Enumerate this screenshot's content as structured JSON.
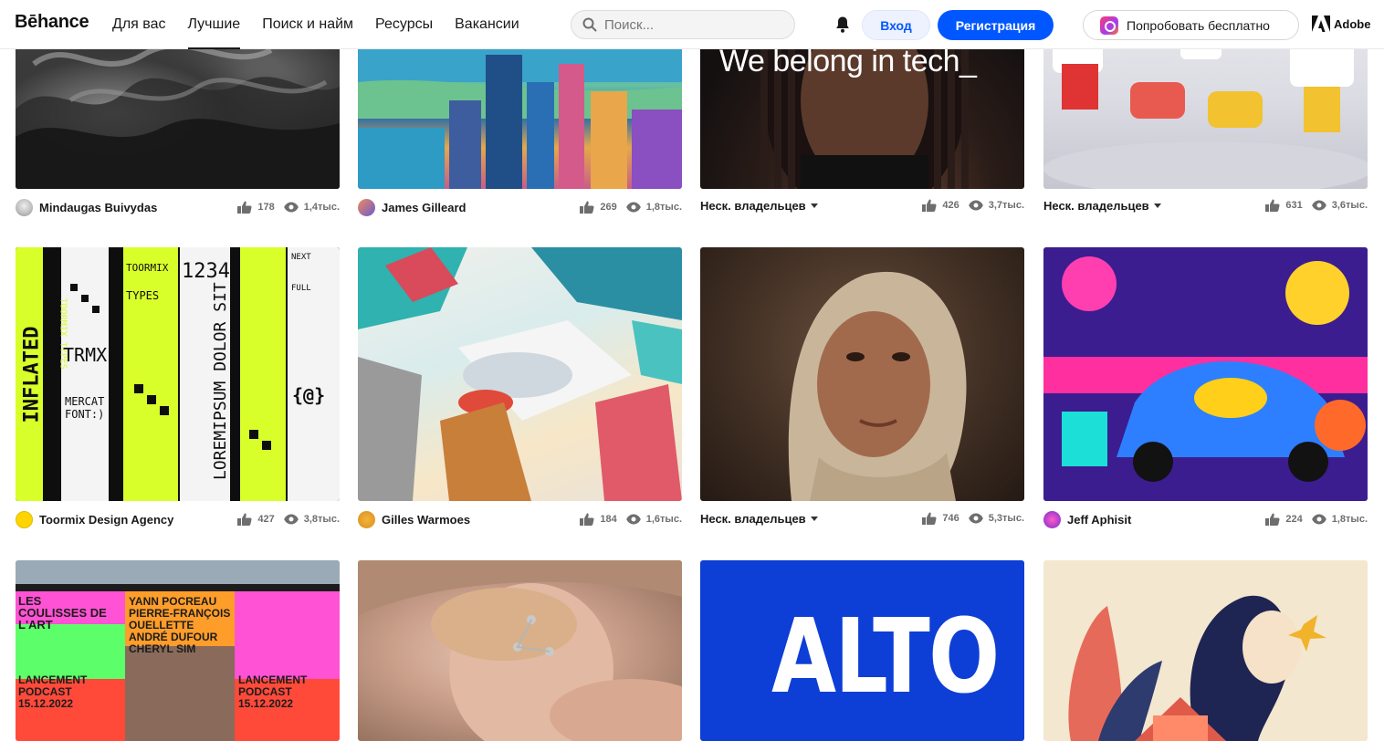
{
  "header": {
    "logo": "Bēhance",
    "nav": [
      {
        "label": "Для вас",
        "active": false
      },
      {
        "label": "Лучшие",
        "active": true
      },
      {
        "label": "Поиск и найм",
        "active": false
      },
      {
        "label": "Ресурсы",
        "active": false
      },
      {
        "label": "Вакансии",
        "active": false
      }
    ],
    "search_placeholder": "Поиск...",
    "login_label": "Вход",
    "signup_label": "Регистрация",
    "try_label": "Попробовать бесплатно",
    "adobe_label": "Adobe",
    "accent_color": "#0057ff"
  },
  "projects": [
    {
      "owner": "Mindaugas Buivydas",
      "multi": false,
      "likes": "178",
      "views": "1,4тыс."
    },
    {
      "owner": "James Gilleard",
      "multi": false,
      "likes": "269",
      "views": "1,8тыс."
    },
    {
      "owner": "Неск. владельцев",
      "multi": true,
      "likes": "426",
      "views": "3,7тыс.",
      "image_text": "We belong in tech_"
    },
    {
      "owner": "Неск. владельцев",
      "multi": true,
      "likes": "631",
      "views": "3,6тыс."
    },
    {
      "owner": "Toormix Design Agency",
      "multi": false,
      "likes": "427",
      "views": "3,8тыс.",
      "image_text": [
        "INFLATED",
        "TOORMIX TYPES",
        "TOORMIX",
        "TYPES",
        "1234",
        "TRMX",
        "MERCAT FONT:)",
        "LOREMIPSUM DOLOR SIT",
        "VERTICAL",
        "NEXT",
        "FULL",
        "{@}"
      ]
    },
    {
      "owner": "Gilles Warmoes",
      "multi": false,
      "likes": "184",
      "views": "1,6тыс."
    },
    {
      "owner": "Неск. владельцев",
      "multi": true,
      "likes": "746",
      "views": "5,3тыс."
    },
    {
      "owner": "Jeff Aphisit",
      "multi": false,
      "likes": "224",
      "views": "1,8тыс."
    },
    {
      "owner": "",
      "multi": false,
      "likes": "",
      "views": "",
      "image_text": [
        "LES COULISSES DE L'ART",
        "YANN POCREAU",
        "PIERRE-FRANÇOIS OUELLETTE",
        "ANDRÉ DUFOUR",
        "CHERYL SIM",
        "LANCEMENT PODCAST",
        "15.12.2022",
        "LANCEMENT PODCAST 15.12.2022"
      ]
    },
    {
      "owner": "",
      "multi": false,
      "likes": "",
      "views": ""
    },
    {
      "owner": "",
      "multi": false,
      "likes": "",
      "views": "",
      "image_text": "ALTO"
    },
    {
      "owner": "",
      "multi": false,
      "likes": "",
      "views": ""
    }
  ]
}
